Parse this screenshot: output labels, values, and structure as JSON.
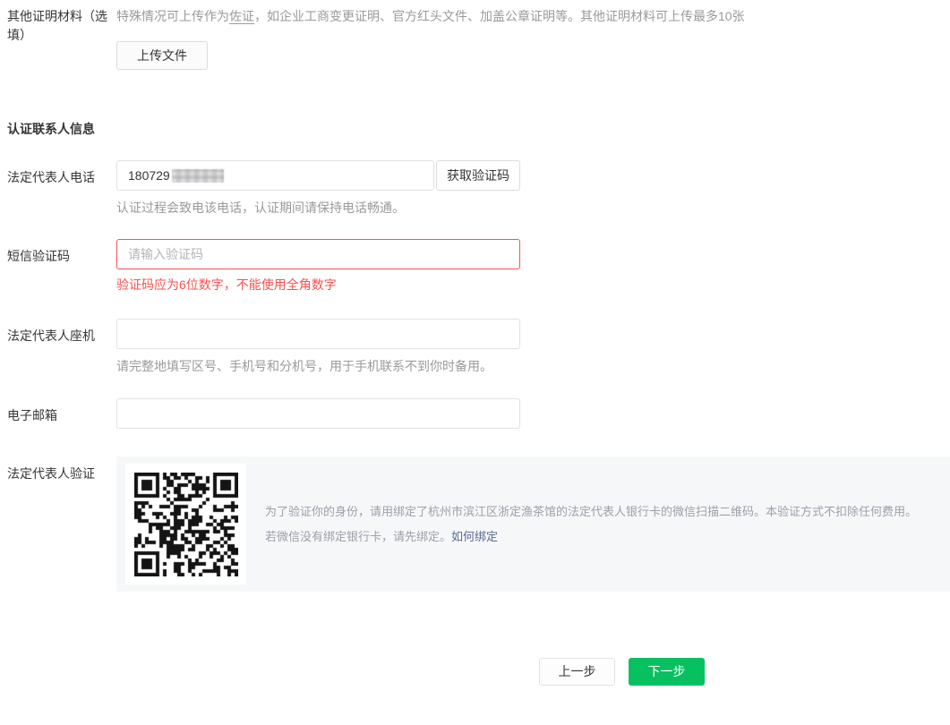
{
  "form": {
    "other_materials": {
      "label": "其他证明材料（选填）",
      "tip_prefix": "特殊情况可上传作为",
      "tip_underlined": "佐证",
      "tip_suffix": "，如企业工商变更证明、官方红头文件、加盖公章证明等。其他证明材料可上传最多10张",
      "upload_button": "上传文件"
    },
    "section_title": "认证联系人信息",
    "phone": {
      "label": "法定代表人电话",
      "value_visible": "180729",
      "value_masked": true,
      "code_button": "获取验证码",
      "help": "认证过程会致电该电话，认证期间请保持电话畅通。"
    },
    "sms_code": {
      "label": "短信验证码",
      "placeholder": "请输入验证码",
      "error": "验证码应为6位数字，不能使用全角数字"
    },
    "landline": {
      "label": "法定代表人座机",
      "value": "",
      "help": "请完整地填写区号、手机号和分机号，用于手机联系不到你时备用。"
    },
    "email": {
      "label": "电子邮箱",
      "value": ""
    },
    "verification": {
      "label": "法定代表人验证",
      "qr_icon": "qr-code",
      "desc_line1": "为了验证你的身份，请用绑定了杭州市滨江区浙定渔茶馆的法定代表人银行卡的微信扫描二维码。本验证方式不扣除任何费用。",
      "desc_line2_prefix": "若微信没有绑定银行卡，请先绑定。",
      "bind_link": "如何绑定"
    }
  },
  "footer": {
    "prev_button": "上一步",
    "next_button": "下一步"
  },
  "colors": {
    "accent_green": "#07c160",
    "error_red": "#fa5151",
    "link_blue": "#576b95",
    "panel_bg": "#f6f7f8",
    "help_gray": "#9a9a9a"
  }
}
